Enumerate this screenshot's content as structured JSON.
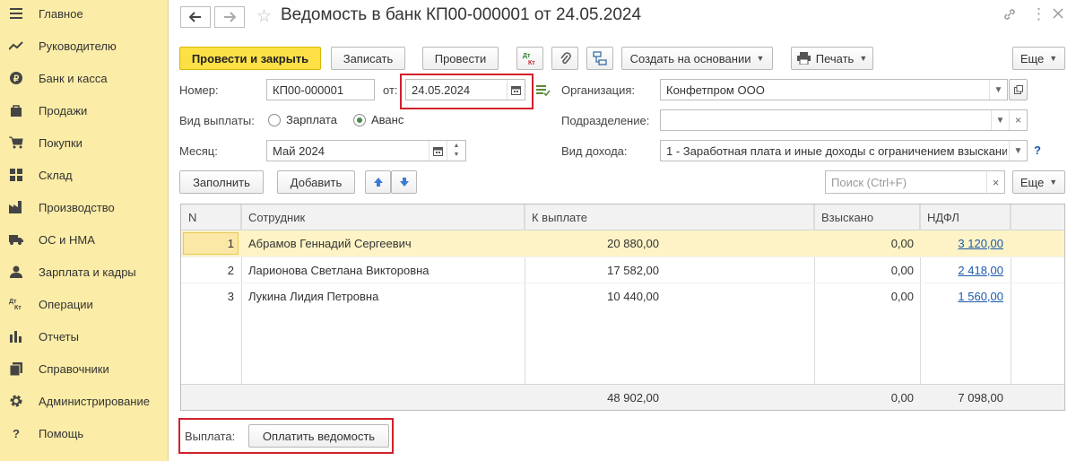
{
  "sidebar": {
    "items": [
      {
        "label": "Главное"
      },
      {
        "label": "Руководителю"
      },
      {
        "label": "Банк и касса"
      },
      {
        "label": "Продажи"
      },
      {
        "label": "Покупки"
      },
      {
        "label": "Склад"
      },
      {
        "label": "Производство"
      },
      {
        "label": "ОС и НМА"
      },
      {
        "label": "Зарплата и кадры"
      },
      {
        "label": "Операции"
      },
      {
        "label": "Отчеты"
      },
      {
        "label": "Справочники"
      },
      {
        "label": "Администрирование"
      },
      {
        "label": "Помощь"
      }
    ]
  },
  "header": {
    "title": "Ведомость в банк КП00-000001 от 24.05.2024",
    "back_icon": "arrow-left-icon",
    "forward_icon": "arrow-right-icon"
  },
  "toolbar": {
    "post_close": "Провести и закрыть",
    "save": "Записать",
    "post": "Провести",
    "dt_kt": "Дт Кт",
    "create_based": "Создать на основании",
    "print": "Печать",
    "more": "Еще"
  },
  "form": {
    "number_label": "Номер:",
    "number_value": "КП00-000001",
    "from_label": "от:",
    "date_value": "24.05.2024",
    "org_label": "Организация:",
    "org_value": "Конфетпром ООО",
    "payment_type_label": "Вид выплаты:",
    "payment_options": [
      "Зарплата",
      "Аванс"
    ],
    "payment_selected": "Аванс",
    "dept_label": "Подразделение:",
    "dept_value": "",
    "month_label": "Месяц:",
    "month_value": "Май 2024",
    "income_label": "Вид дохода:",
    "income_value": "1 - Заработная плата и иные доходы с ограничением взыскания",
    "help": "?"
  },
  "table_toolbar": {
    "fill": "Заполнить",
    "add": "Добавить",
    "search_placeholder": "Поиск (Ctrl+F)",
    "clear": "×",
    "more": "Еще"
  },
  "table": {
    "columns": [
      "N",
      "Сотрудник",
      "К выплате",
      "Взыскано",
      "НДФЛ"
    ],
    "rows": [
      {
        "n": "1",
        "employee": "Абрамов Геннадий Сергеевич",
        "to_pay": "20 880,00",
        "recovered": "0,00",
        "ndfl": "3 120,00"
      },
      {
        "n": "2",
        "employee": "Ларионова Светлана Викторовна",
        "to_pay": "17 582,00",
        "recovered": "0,00",
        "ndfl": "2 418,00"
      },
      {
        "n": "3",
        "employee": "Лукина Лидия Петровна",
        "to_pay": "10 440,00",
        "recovered": "0,00",
        "ndfl": "1 560,00"
      }
    ],
    "totals": {
      "to_pay": "48 902,00",
      "recovered": "0,00",
      "ndfl": "7 098,00"
    }
  },
  "footer": {
    "payment_label": "Выплата:",
    "pay_button": "Оплатить ведомость"
  },
  "colors": {
    "sidebar_bg": "#fbeca7",
    "primary_button": "#fce045",
    "highlight": "#d1202b",
    "selected_row": "#fdf3c6",
    "link": "#1c5aa9"
  }
}
